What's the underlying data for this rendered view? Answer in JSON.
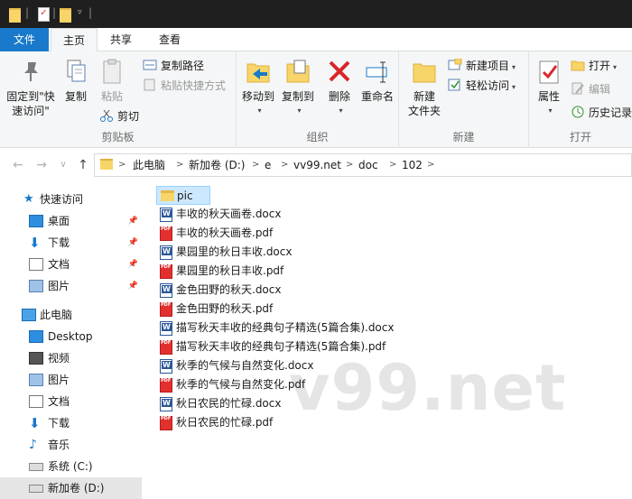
{
  "titlebar": {
    "separator": "|",
    "dropdown": "▿"
  },
  "tabs": {
    "file": "文件",
    "home": "主页",
    "share": "共享",
    "view": "查看"
  },
  "ribbon": {
    "clipboard": {
      "label": "剪贴板",
      "pin_line1": "固定到\"快",
      "pin_line2": "速访问\"",
      "copy": "复制",
      "paste": "粘贴",
      "copy_path": "复制路径",
      "paste_shortcut": "粘贴快捷方式",
      "cut": "剪切"
    },
    "organize": {
      "label": "组织",
      "move_to": "移动到",
      "copy_to": "复制到",
      "delete": "删除",
      "rename": "重命名"
    },
    "new": {
      "label": "新建",
      "new_folder_line1": "新建",
      "new_folder_line2": "文件夹",
      "new_item": "新建项目",
      "easy_access": "轻松访问"
    },
    "open": {
      "label": "打开",
      "properties": "属性",
      "open": "打开",
      "edit": "编辑",
      "history": "历史记录"
    },
    "caret": "▾"
  },
  "address": {
    "back": "←",
    "forward": "→",
    "recent": "∨",
    "up": "↑",
    "chevron": ">",
    "crumbs": [
      "此电脑",
      "新加卷 (D:)",
      "e",
      "vv99.net",
      "doc",
      "102"
    ]
  },
  "nav": {
    "pin_icon": "📌",
    "items": [
      {
        "label": "快速访问"
      },
      {
        "label": "桌面"
      },
      {
        "label": "下载"
      },
      {
        "label": "文档"
      },
      {
        "label": "图片"
      },
      {
        "label": "此电脑"
      },
      {
        "label": "Desktop"
      },
      {
        "label": "视频"
      },
      {
        "label": "图片"
      },
      {
        "label": "文档"
      },
      {
        "label": "下载"
      },
      {
        "label": "音乐"
      },
      {
        "label": "系统 (C:)"
      },
      {
        "label": "新加卷 (D:)"
      }
    ]
  },
  "files": [
    {
      "name": "pic",
      "type": "folder"
    },
    {
      "name": "丰收的秋天画卷.docx",
      "type": "docx"
    },
    {
      "name": "丰收的秋天画卷.pdf",
      "type": "pdf"
    },
    {
      "name": "果园里的秋日丰收.docx",
      "type": "docx"
    },
    {
      "name": "果园里的秋日丰收.pdf",
      "type": "pdf"
    },
    {
      "name": "金色田野的秋天.docx",
      "type": "docx"
    },
    {
      "name": "金色田野的秋天.pdf",
      "type": "pdf"
    },
    {
      "name": "描写秋天丰收的经典句子精选(5篇合集).docx",
      "type": "docx"
    },
    {
      "name": "描写秋天丰收的经典句子精选(5篇合集).pdf",
      "type": "pdf"
    },
    {
      "name": "秋季的气候与自然变化.docx",
      "type": "docx"
    },
    {
      "name": "秋季的气候与自然变化.pdf",
      "type": "pdf"
    },
    {
      "name": "秋日农民的忙碌.docx",
      "type": "docx"
    },
    {
      "name": "秋日农民的忙碌.pdf",
      "type": "pdf"
    }
  ],
  "watermark": "v99.net",
  "colors": {
    "accent": "#1979ca",
    "selection": "#cce8ff",
    "folder": "#f8d568",
    "pdf": "#e2302e",
    "word": "#2b5797"
  }
}
